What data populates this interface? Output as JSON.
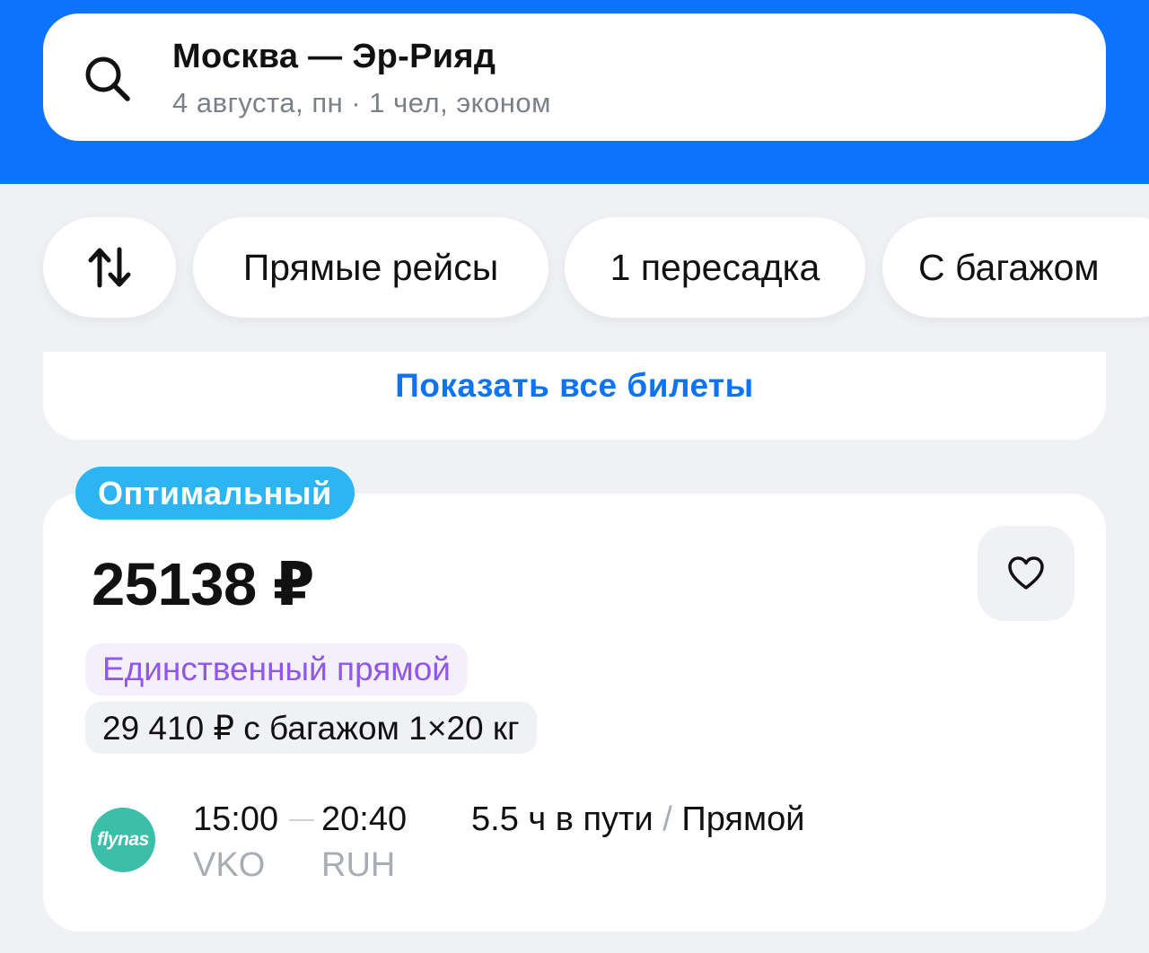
{
  "search": {
    "route": "Москва — Эр-Рияд",
    "details": "4 августа, пн · 1 чел, эконом"
  },
  "filters": {
    "items": [
      "Прямые рейсы",
      "1 пересадка",
      "С багажом"
    ]
  },
  "show_all": {
    "label": "Показать все билеты"
  },
  "ticket": {
    "badge": "Оптимальный",
    "price": "25138 ₽",
    "tag_direct": "Единственный прямой",
    "tag_baggage": "29 410 ₽ с багажом 1×20 кг",
    "airline": "flynas",
    "departure_time": "15:00",
    "arrival_time": "20:40",
    "departure_code": "VKO",
    "arrival_code": "RUH",
    "duration": "5.5 ч в пути",
    "separator": "/",
    "stops": "Прямой"
  },
  "colors": {
    "header_blue": "#0d73fd",
    "badge_blue": "#2db5f3",
    "tag_purple": "#8f57ee",
    "airline_green": "#3bbfa9"
  }
}
